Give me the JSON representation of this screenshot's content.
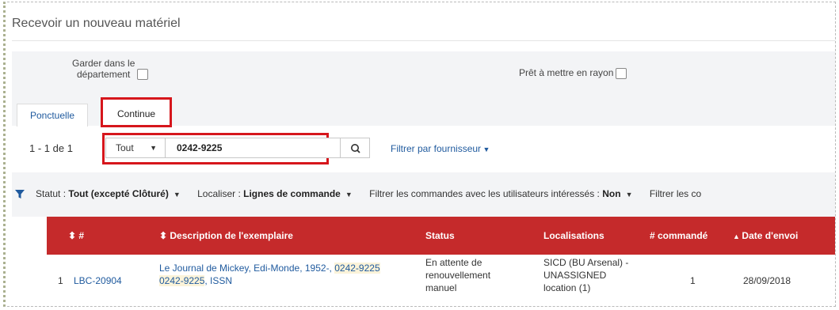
{
  "page": {
    "title": "Recevoir un nouveau matériel"
  },
  "options": {
    "keep_line1": "Garder dans le",
    "keep_line2": "département",
    "ready": "Prêt à mettre en rayon"
  },
  "tabs": [
    {
      "label": "Ponctuelle"
    },
    {
      "label": "Continue"
    }
  ],
  "search": {
    "count": "1 - 1 de 1",
    "scope": "Tout",
    "value": "0242-9225",
    "vendor_filter": "Filtrer par fournisseur"
  },
  "filters": {
    "status_label": "Statut :",
    "status_value": "Tout (excepté Clôturé)",
    "locate_label": "Localiser :",
    "locate_value": "Lignes de commande",
    "interested_label": "Filtrer les commandes avec les utilisateurs intéressés :",
    "interested_value": "Non",
    "more_label": "Filtrer les co"
  },
  "table": {
    "headers": {
      "num": "#",
      "desc": "Description de l'exemplaire",
      "status": "Status",
      "loc": "Localisations",
      "ordered": "# commandé",
      "date": "Date d'envoi"
    },
    "rows": [
      {
        "index": "1",
        "po_line": "LBC-20904",
        "desc_part1": "Le Journal de Mickey, Edi-Monde, 1952-, ",
        "desc_issn1": "0242-9225",
        "desc_issn2": "0242-9225",
        "desc_part2": ", ISSN",
        "status_l1": "En attente de",
        "status_l2": "renouvellement",
        "status_l3": "manuel",
        "loc_l1": "SICD (BU Arsenal) -",
        "loc_l2": "UNASSIGNED",
        "loc_l3": "location (1)",
        "ordered": "1",
        "date": "28/09/2018"
      }
    ]
  },
  "colors": {
    "header_bg": "#c52a2b",
    "highlight_border": "#d6161c",
    "link": "#1f5a9e"
  }
}
